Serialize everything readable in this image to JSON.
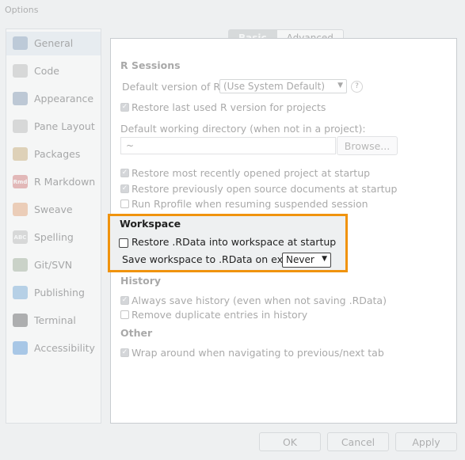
{
  "window": {
    "title": "Options"
  },
  "sidebar": {
    "items": [
      {
        "label": "General",
        "icon": "r-logo-icon",
        "color": "#7a98b8",
        "selected": true
      },
      {
        "label": "Code",
        "icon": "code-icon",
        "color": "#b8b8b8"
      },
      {
        "label": "Appearance",
        "icon": "appearance-icon",
        "color": "#7c93b0"
      },
      {
        "label": "Pane Layout",
        "icon": "pane-layout-icon",
        "color": "#b8b8b8"
      },
      {
        "label": "Packages",
        "icon": "packages-icon",
        "color": "#c9a76a"
      },
      {
        "label": "R Markdown",
        "icon": "rmarkdown-icon",
        "color": "#d36c6c",
        "glyph": "Rmd"
      },
      {
        "label": "Sweave",
        "icon": "sweave-icon",
        "color": "#e89f6a"
      },
      {
        "label": "Spelling",
        "icon": "spelling-icon",
        "color": "#b8b8b8",
        "glyph": "ABC"
      },
      {
        "label": "Git/SVN",
        "icon": "git-icon",
        "color": "#9aaa90"
      },
      {
        "label": "Publishing",
        "icon": "publishing-icon",
        "color": "#6aa6d8"
      },
      {
        "label": "Terminal",
        "icon": "terminal-icon",
        "color": "#555555"
      },
      {
        "label": "Accessibility",
        "icon": "accessibility-icon",
        "color": "#4a90d9"
      }
    ]
  },
  "tabs": {
    "basic": "Basic",
    "advanced": "Advanced"
  },
  "r_sessions": {
    "header": "R Sessions",
    "default_version_label": "Default version of R:",
    "default_version_value": "(Use System Default)",
    "help_glyph": "?",
    "restore_last_version": "Restore last used R version for projects",
    "default_wd_label": "Default working directory (when not in a project):",
    "default_wd_value": "~",
    "browse_button": "Browse...",
    "restore_project": "Restore most recently opened project at startup",
    "restore_docs": "Restore previously open source documents at startup",
    "run_rprofile": "Run Rprofile when resuming suspended session"
  },
  "workspace": {
    "header": "Workspace",
    "restore_rdata": "Restore .RData into workspace at startup",
    "save_label": "Save workspace to .RData on exit:",
    "save_value": "Never"
  },
  "history": {
    "header": "History",
    "always_save": "Always save history (even when not saving .RData)",
    "remove_duplicates": "Remove duplicate entries in history"
  },
  "other": {
    "header": "Other",
    "wrap_around": "Wrap around when navigating to previous/next tab"
  },
  "footer": {
    "ok": "OK",
    "cancel": "Cancel",
    "apply": "Apply"
  },
  "check_glyph": "✓",
  "colors": {
    "highlight": "#f0930e"
  }
}
